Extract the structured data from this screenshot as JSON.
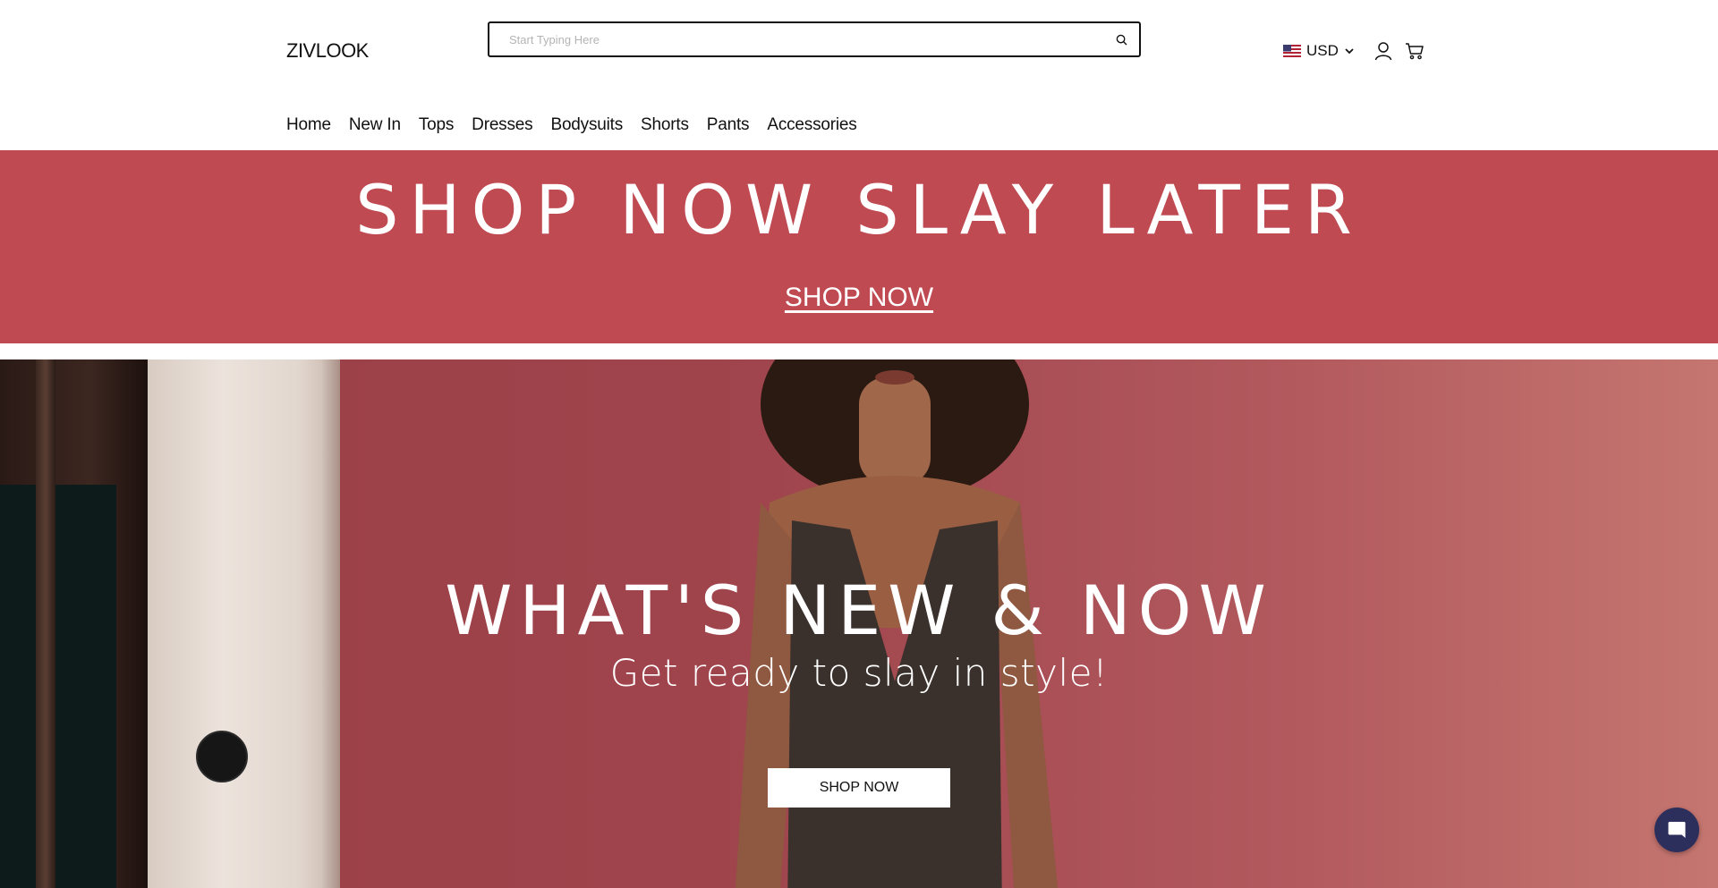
{
  "header": {
    "logo": "ZIVLOOK",
    "search": {
      "placeholder": "Start Typing Here",
      "value": ""
    },
    "currency": "USD",
    "icons": [
      "search-icon",
      "us-flag-icon",
      "chevron-down-icon",
      "user-icon",
      "cart-icon"
    ]
  },
  "nav": {
    "items": [
      {
        "label": "Home"
      },
      {
        "label": "New In"
      },
      {
        "label": "Tops"
      },
      {
        "label": "Dresses"
      },
      {
        "label": "Bodysuits"
      },
      {
        "label": "Shorts"
      },
      {
        "label": "Pants"
      },
      {
        "label": "Accessories"
      }
    ]
  },
  "promo": {
    "title": "SHOP NOW SLAY LATER",
    "link": "SHOP NOW",
    "background": "#bf4a52"
  },
  "hero": {
    "title": "WHAT'S NEW & NOW",
    "subtitle": "Get ready to slay in style!",
    "button": "SHOP NOW",
    "background": "#a0454d"
  },
  "chat": {
    "icon": "chat-bubble-icon",
    "color": "#2c2f5c"
  }
}
